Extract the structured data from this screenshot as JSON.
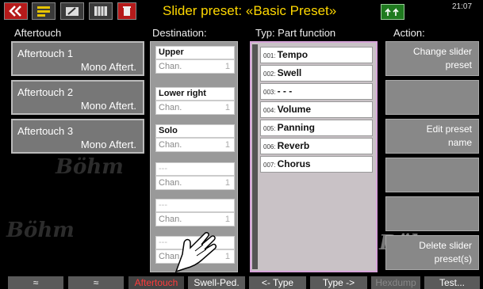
{
  "topbar": {
    "title": "Slider preset: «Basic Preset»",
    "clock": "21:07",
    "icons": [
      "back-double-chevron-icon",
      "preset-icon",
      "edit-icon",
      "register-icon",
      "trash-icon",
      "up-arrows-icon"
    ]
  },
  "columns": {
    "aftertouch": "Aftertouch",
    "destination": "Destination:",
    "typ": "Typ:  Part function",
    "action": "Action:"
  },
  "aftertouch_items": [
    {
      "name": "Aftertouch 1",
      "value": "Mono Aftert."
    },
    {
      "name": "Aftertouch 2",
      "value": "Mono Aftert."
    },
    {
      "name": "Aftertouch 3",
      "value": "Mono Aftert."
    }
  ],
  "watermark": "Böhm",
  "destinations": [
    {
      "part": "Upper",
      "chan": "Chan.",
      "num": "1"
    },
    {
      "part": "Lower right",
      "chan": "Chan.",
      "num": "1"
    },
    {
      "part": "Solo",
      "chan": "Chan.",
      "num": "1"
    },
    {
      "part": "---",
      "chan": "Chan.",
      "num": "1"
    },
    {
      "part": "---",
      "chan": "Chan.",
      "num": "1"
    },
    {
      "part": "---",
      "chan": "Chan.",
      "num": "1"
    }
  ],
  "types": [
    {
      "n": "001:",
      "label": "Tempo"
    },
    {
      "n": "002:",
      "label": "Swell"
    },
    {
      "n": "003:",
      "label": "- - -"
    },
    {
      "n": "004:",
      "label": "Volume"
    },
    {
      "n": "005:",
      "label": "Panning"
    },
    {
      "n": "006:",
      "label": "Reverb"
    },
    {
      "n": "007:",
      "label": "Chorus"
    }
  ],
  "actions": [
    {
      "line1": "Change slider",
      "line2": "preset"
    },
    {
      "line1": "",
      "line2": ""
    },
    {
      "line1": "Edit preset",
      "line2": "name"
    },
    {
      "line1": "",
      "line2": ""
    },
    {
      "line1": "",
      "line2": ""
    },
    {
      "line1": "Delete slider",
      "line2": "preset(s)"
    }
  ],
  "bottombar": {
    "up": "≈",
    "down": "≈",
    "aftertouch": "Aftertouch",
    "swell": "Swell-Ped.",
    "type_prev": "<- Type",
    "type_next": "Type ->",
    "hexdump": "Hexdump",
    "test": "Test..."
  },
  "colors": {
    "title": "#ffd800",
    "active_tab": "#ff3b3b",
    "typ_border": "#d6a4d9"
  }
}
